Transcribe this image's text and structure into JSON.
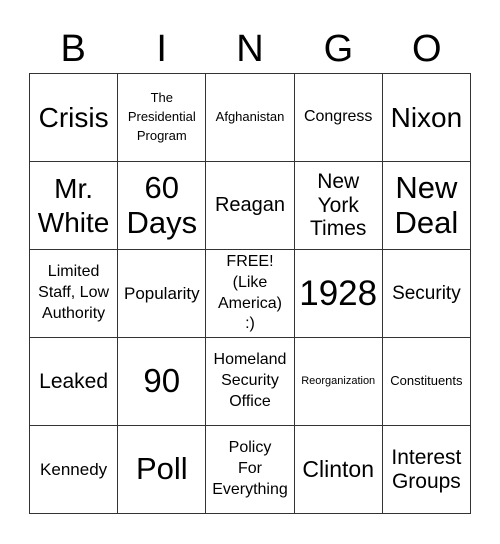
{
  "header": {
    "letters": [
      "B",
      "I",
      "N",
      "G",
      "O"
    ]
  },
  "cells": [
    "Crisis",
    "The\nPresidential\nProgram",
    "Afghanistan",
    "Congress",
    "Nixon",
    "Mr.\nWhite",
    "60\nDays",
    "Reagan",
    "New\nYork\nTimes",
    "New\nDeal",
    "Limited\nStaff, Low\nAuthority",
    "Popularity",
    "FREE!\n(Like\nAmerica)\n:)",
    "1928",
    "Security",
    "Leaked",
    "90",
    "Homeland\nSecurity\nOffice",
    "Reorganization",
    "Constituents",
    "Kennedy",
    "Poll",
    "Policy\nFor\nEverything",
    "Clinton",
    "Interest\nGroups"
  ]
}
